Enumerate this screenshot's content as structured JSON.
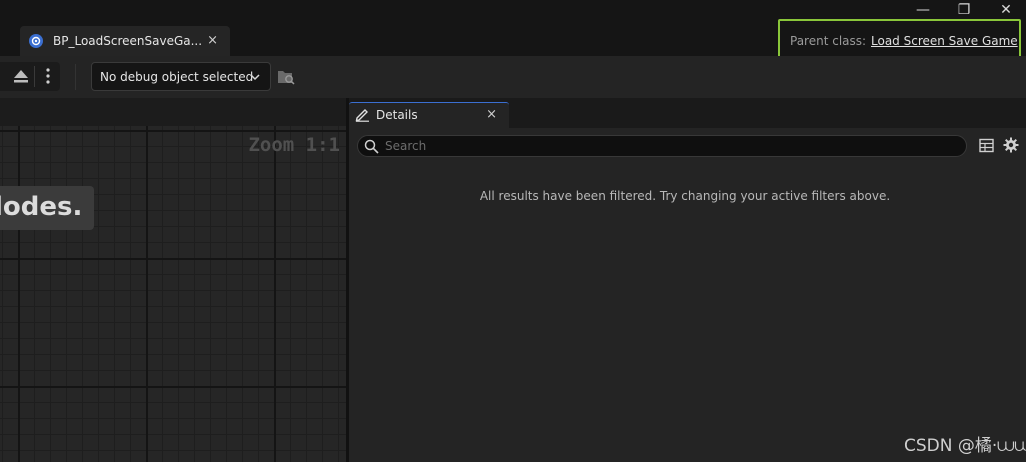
{
  "tab": {
    "title": "BP_LoadScreenSaveGa...",
    "close_glyph": "×",
    "icon": "blueprint-icon"
  },
  "window": {
    "minimize_glyph": "—",
    "restore_glyph": "❐",
    "close_glyph": "✕"
  },
  "parent_class": {
    "label": "Parent class:",
    "value": "Load Screen Save Game",
    "highlight_color": "#8ac63a"
  },
  "toolbar": {
    "debug_object": "No debug object selected"
  },
  "graph": {
    "zoom": "Zoom 1:1",
    "overlay_text": "lodes."
  },
  "details": {
    "title": "Details",
    "close_glyph": "×",
    "search_placeholder": "Search",
    "empty_message": "All results have been filtered. Try changing your active filters above."
  },
  "watermark": "CSDN @橘·⩊⩊",
  "colors": {
    "accent": "#3b6fd1",
    "background": "#151515",
    "panel": "#242424"
  }
}
